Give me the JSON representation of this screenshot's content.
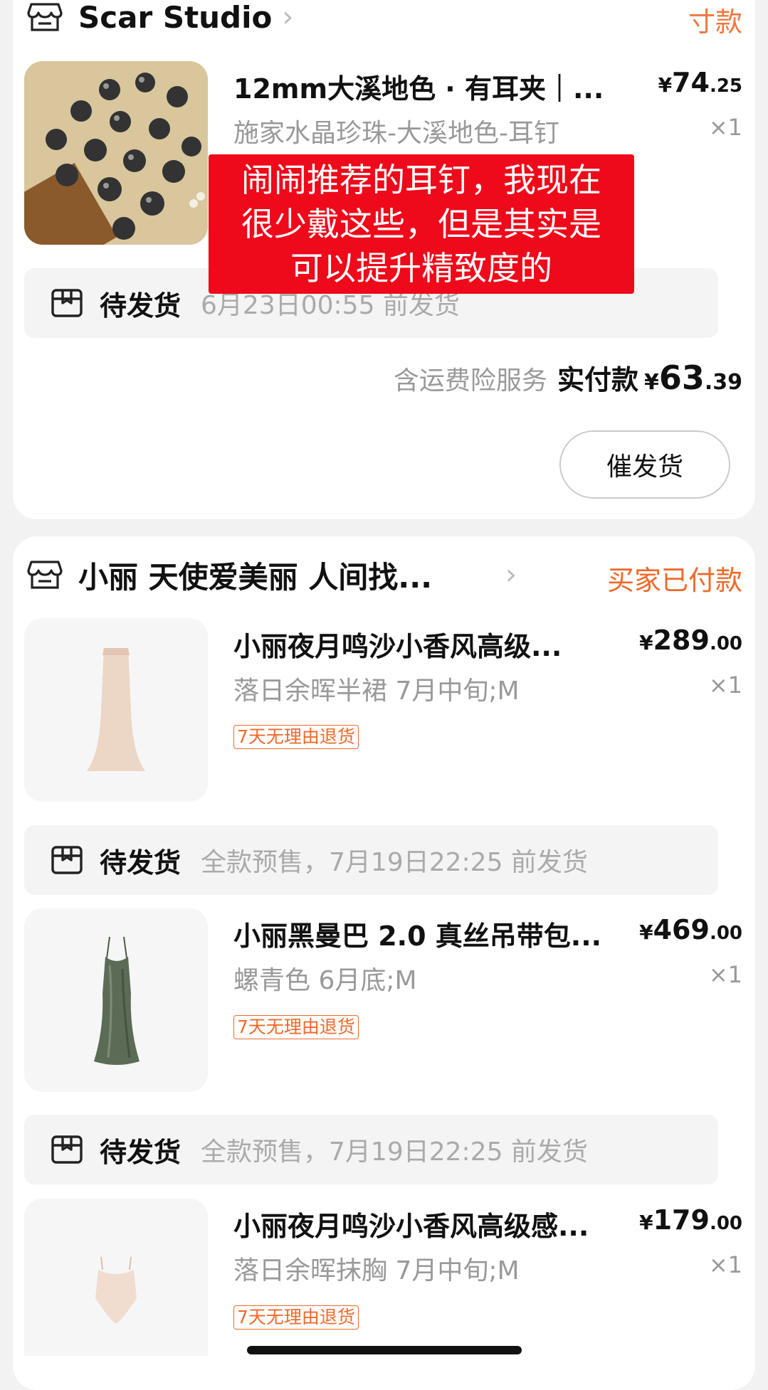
{
  "store1": {
    "name": "Scar Studio",
    "status": "寸款",
    "item": {
      "title": "12mm大溪地色 · 有耳夹｜...",
      "price_cur": "¥",
      "price_int": "74",
      "price_dec": ".25",
      "spec": "施家水晶珍珠-大溪地色-耳钉",
      "qty": "×1"
    },
    "shipping": {
      "label": "待发货",
      "info": "6月23日00:55 前发货"
    },
    "service": "含运费险服务",
    "paid_label": "实付款",
    "paid_cur": "¥",
    "paid_int": "63",
    "paid_dec": ".39",
    "button": "催发货"
  },
  "overlay_note": {
    "line1": "闹闹推荐的耳钉，我现在",
    "line2": "很少戴这些，但是其实是",
    "line3": "可以提升精致度的"
  },
  "store2": {
    "name": "小丽 天使爱美丽 人间找...",
    "status": "买家已付款",
    "items": [
      {
        "title": "小丽夜月鸣沙小香风高级...",
        "price_cur": "¥",
        "price_int": "289",
        "price_dec": ".00",
        "spec": "落日余晖半裙 7月中旬;M",
        "qty": "×1",
        "tag": "7天无理由退货"
      },
      {
        "title": "小丽黑曼巴 2.0 真丝吊带包...",
        "price_cur": "¥",
        "price_int": "469",
        "price_dec": ".00",
        "spec": "螺青色 6月底;M",
        "qty": "×1",
        "tag": "7天无理由退货"
      },
      {
        "title": "小丽夜月鸣沙小香风高级感...",
        "price_cur": "¥",
        "price_int": "179",
        "price_dec": ".00",
        "spec": "落日余晖抹胸 7月中旬;M",
        "qty": "×1",
        "tag": "7天无理由退货"
      }
    ],
    "shipping": [
      {
        "label": "待发货",
        "info": "全款预售，7月19日22:25 前发货"
      },
      {
        "label": "待发货",
        "info": "全款预售，7月19日22:25 前发货"
      }
    ]
  },
  "colors": {
    "accent": "#f0692a",
    "overlay": "#ee0a1a",
    "background": "#f2f2f2"
  },
  "icons": [
    "store-icon",
    "package-icon",
    "chevron-right-icon"
  ]
}
